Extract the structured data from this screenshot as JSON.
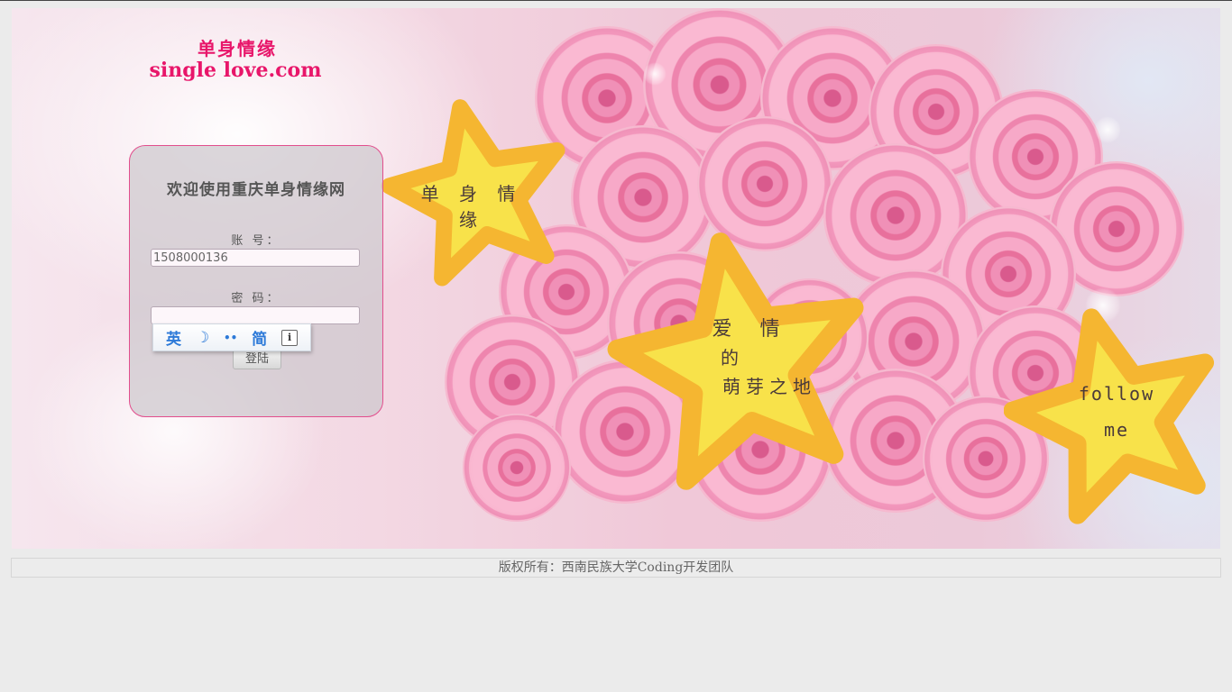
{
  "logo": {
    "chinese": "单身情缘",
    "english": "single love.com"
  },
  "login": {
    "title": "欢迎使用重庆单身情缘网",
    "account_label": "账 号：",
    "account_value": "1508000136",
    "password_label": "密 码：",
    "password_value": "",
    "submit_label": "登陆"
  },
  "ime_toolbar": {
    "items": [
      "英",
      "☽",
      "••",
      "简",
      "i"
    ]
  },
  "stars": {
    "star1": "单 身 情 缘",
    "star2_line1": "爱  情",
    "star2_line2": "的",
    "star2_line3": "萌芽之地",
    "star3_line1": "follow",
    "star3_line2": "me"
  },
  "footer": {
    "copyright": "版权所有：西南民族大学Coding开发团队"
  },
  "colors": {
    "brand_pink": "#e8166a",
    "panel_border": "#e24e8d",
    "star_yellow": "#f8e24a",
    "star_orange": "#f5b631"
  }
}
